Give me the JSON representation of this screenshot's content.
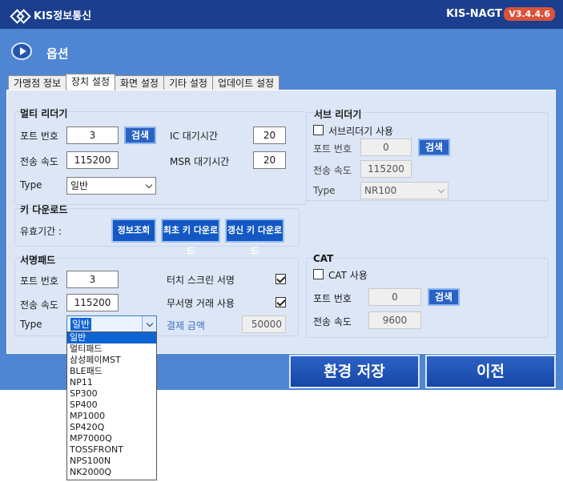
{
  "app": {
    "brand": "KIS정보통신",
    "name": "KIS-NAGT",
    "version": "V3.4.4.6"
  },
  "header": {
    "title": "옵션"
  },
  "tabs": [
    {
      "label": "가맹점 정보"
    },
    {
      "label": "장치 설정"
    },
    {
      "label": "화면 설정"
    },
    {
      "label": "기타 설정"
    },
    {
      "label": "업데이트 설정"
    }
  ],
  "multi_reader": {
    "title": "멀티 리더기",
    "port_label": "포트 번호",
    "port_value": "3",
    "search_label": "검색",
    "speed_label": "전송 속도",
    "speed_value": "115200",
    "type_label": "Type",
    "type_value": "일반",
    "ic_wait_label": "IC 대기시간",
    "ic_wait_value": "20",
    "msr_wait_label": "MSR 대기시간",
    "msr_wait_value": "20"
  },
  "sub_reader": {
    "title": "서브 리더기",
    "use_label": "서브리더기 사용",
    "use_checked": false,
    "port_label": "포트 번호",
    "port_value": "0",
    "search_label": "검색",
    "speed_label": "전송 속도",
    "speed_value": "115200",
    "type_label": "Type",
    "type_value": "NR100"
  },
  "key_download": {
    "title": "키 다운로드",
    "valid_label": "유효기간 :",
    "info_btn": "정보조회",
    "first_btn": "최초 키 다운로드",
    "renew_btn": "갱신 키 다운로드"
  },
  "sign_pad": {
    "title": "서명패드",
    "port_label": "포트 번호",
    "port_value": "3",
    "speed_label": "전송 속도",
    "speed_value": "115200",
    "type_label": "Type",
    "type_value": "일반",
    "touch_label": "터치 스크린 서명",
    "touch_checked": true,
    "unsigned_label": "무서명 거래 사용",
    "unsigned_checked": true,
    "amount_label": "결제 금액",
    "amount_value": "50000"
  },
  "cat": {
    "title": "CAT",
    "use_label": "CAT 사용",
    "use_checked": false,
    "port_label": "포트 번호",
    "port_value": "0",
    "search_label": "검색",
    "speed_label": "전송 속도",
    "speed_value": "9600"
  },
  "buttons": {
    "save": "환경 저장",
    "prev": "이전"
  },
  "dropdown": {
    "options": [
      "일반",
      "멀티패드",
      "삼성페이MST",
      "BLE패드",
      "NP11",
      "SP300",
      "SP400",
      "MP1000",
      "SP420Q",
      "MP7000Q",
      "TOSSFRONT",
      "NPS100N",
      "NK2000Q"
    ]
  },
  "colors": {
    "titlebar": "#1b3f8e",
    "window": "#4f86d4",
    "panel": "#dce6f6",
    "accent": "#1358c4",
    "version_badge": "#d9533b"
  }
}
